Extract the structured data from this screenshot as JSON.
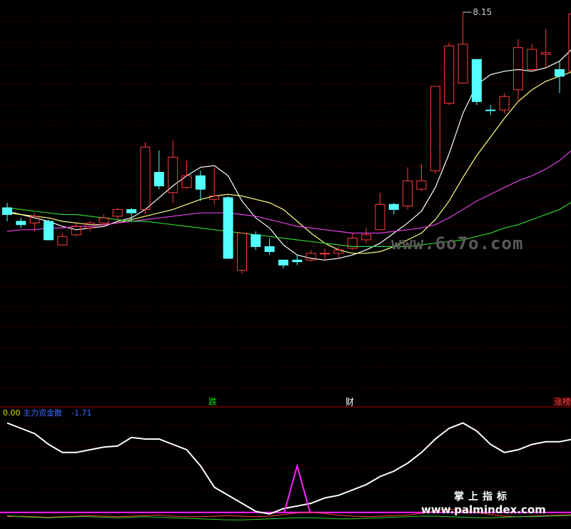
{
  "chart_data": {
    "type": "candlestick",
    "price_panel": {
      "max_label": "8.15",
      "candles": [
        {
          "o": 6.95,
          "c": 6.99,
          "h": 7.02,
          "l": 6.91,
          "up": false
        },
        {
          "o": 6.91,
          "c": 6.89,
          "h": 6.93,
          "l": 6.87,
          "up": false
        },
        {
          "o": 6.9,
          "c": 6.94,
          "h": 6.96,
          "l": 6.85,
          "up": true
        },
        {
          "o": 6.91,
          "c": 6.8,
          "h": 6.92,
          "l": 6.8,
          "up": false
        },
        {
          "o": 6.77,
          "c": 6.82,
          "h": 6.84,
          "l": 6.77,
          "up": true
        },
        {
          "o": 6.83,
          "c": 6.88,
          "h": 6.9,
          "l": 6.82,
          "up": true
        },
        {
          "o": 6.87,
          "c": 6.9,
          "h": 6.91,
          "l": 6.85,
          "up": true
        },
        {
          "o": 6.9,
          "c": 6.93,
          "h": 6.95,
          "l": 6.88,
          "up": true
        },
        {
          "o": 6.94,
          "c": 6.98,
          "h": 6.99,
          "l": 6.92,
          "up": true
        },
        {
          "o": 6.98,
          "c": 6.96,
          "h": 6.99,
          "l": 6.91,
          "up": false
        },
        {
          "o": 6.98,
          "c": 7.35,
          "h": 7.38,
          "l": 6.95,
          "up": true
        },
        {
          "o": 7.12,
          "c": 7.2,
          "h": 7.33,
          "l": 7.1,
          "up": false
        },
        {
          "o": 7.08,
          "c": 7.29,
          "h": 7.39,
          "l": 7.02,
          "up": true
        },
        {
          "o": 7.11,
          "c": 7.18,
          "h": 7.27,
          "l": 7.1,
          "up": true
        },
        {
          "o": 7.18,
          "c": 7.1,
          "h": 7.21,
          "l": 7.03,
          "up": false
        },
        {
          "o": 7.04,
          "c": 7.06,
          "h": 7.23,
          "l": 7.01,
          "up": true
        },
        {
          "o": 7.05,
          "c": 6.69,
          "h": 7.06,
          "l": 6.69,
          "up": false
        },
        {
          "o": 6.84,
          "c": 6.62,
          "h": 6.84,
          "l": 6.6,
          "up": true
        },
        {
          "o": 6.83,
          "c": 6.76,
          "h": 6.85,
          "l": 6.74,
          "up": false
        },
        {
          "o": 6.76,
          "c": 6.73,
          "h": 6.81,
          "l": 6.71,
          "up": false
        },
        {
          "o": 6.68,
          "c": 6.65,
          "h": 6.68,
          "l": 6.63,
          "up": false
        },
        {
          "o": 6.67,
          "c": 6.68,
          "h": 6.71,
          "l": 6.65,
          "up": false
        },
        {
          "o": 6.68,
          "c": 6.72,
          "h": 6.74,
          "l": 6.67,
          "up": true
        },
        {
          "o": 6.72,
          "c": 6.72,
          "h": 6.75,
          "l": 6.68,
          "up": true
        },
        {
          "o": 6.72,
          "c": 6.74,
          "h": 6.76,
          "l": 6.69,
          "up": true
        },
        {
          "o": 6.75,
          "c": 6.81,
          "h": 6.84,
          "l": 6.74,
          "up": true
        },
        {
          "o": 6.8,
          "c": 6.83,
          "h": 6.87,
          "l": 6.78,
          "up": true
        },
        {
          "o": 6.86,
          "c": 7.01,
          "h": 7.08,
          "l": 6.86,
          "up": true
        },
        {
          "o": 7.01,
          "c": 6.98,
          "h": 7.02,
          "l": 6.95,
          "up": false
        },
        {
          "o": 7.0,
          "c": 7.15,
          "h": 7.23,
          "l": 6.98,
          "up": true
        },
        {
          "o": 7.1,
          "c": 7.15,
          "h": 7.25,
          "l": 7.09,
          "up": true
        },
        {
          "o": 7.21,
          "c": 7.71,
          "h": 7.71,
          "l": 7.19,
          "up": true
        },
        {
          "o": 7.61,
          "c": 7.95,
          "h": 7.97,
          "l": 7.6,
          "up": true
        },
        {
          "o": 7.73,
          "c": 7.96,
          "h": 8.15,
          "l": 7.73,
          "up": true
        },
        {
          "o": 7.87,
          "c": 7.62,
          "h": 7.87,
          "l": 7.6,
          "up": false
        },
        {
          "o": 7.57,
          "c": 7.57,
          "h": 7.6,
          "l": 7.54,
          "up": false
        },
        {
          "o": 7.57,
          "c": 7.65,
          "h": 7.67,
          "l": 7.55,
          "up": true
        },
        {
          "o": 7.69,
          "c": 7.94,
          "h": 7.99,
          "l": 7.62,
          "up": true
        },
        {
          "o": 7.81,
          "c": 7.93,
          "h": 7.96,
          "l": 7.8,
          "up": true
        },
        {
          "o": 7.9,
          "c": 7.91,
          "h": 8.05,
          "l": 7.82,
          "up": true
        },
        {
          "o": 7.81,
          "c": 7.77,
          "h": 7.86,
          "l": 7.67,
          "up": false
        },
        {
          "o": 7.8,
          "c": 8.14,
          "h": 8.14,
          "l": 7.8,
          "up": true
        }
      ],
      "moving_averages": [
        {
          "color": "#ffffff",
          "values": [
            6.97,
            6.95,
            6.93,
            6.91,
            6.88,
            6.86,
            6.87,
            6.88,
            6.91,
            6.93,
            6.98,
            7.05,
            7.12,
            7.18,
            7.23,
            7.24,
            7.18,
            7.03,
            6.93,
            6.87,
            6.77,
            6.71,
            6.69,
            6.68,
            6.69,
            6.71,
            6.74,
            6.78,
            6.84,
            6.9,
            6.97,
            7.11,
            7.31,
            7.55,
            7.72,
            7.78,
            7.8,
            7.81,
            7.8,
            7.82,
            7.86,
            7.94
          ]
        },
        {
          "color": "#ffff80",
          "values": [
            6.96,
            6.95,
            6.94,
            6.93,
            6.91,
            6.9,
            6.89,
            6.89,
            6.9,
            6.92,
            6.94,
            6.96,
            6.98,
            7.01,
            7.04,
            7.06,
            7.07,
            7.06,
            7.04,
            7.02,
            6.98,
            6.91,
            6.84,
            6.78,
            6.74,
            6.72,
            6.72,
            6.73,
            6.76,
            6.8,
            6.84,
            6.92,
            7.03,
            7.17,
            7.3,
            7.41,
            7.52,
            7.62,
            7.69,
            7.74,
            7.77,
            7.8
          ]
        },
        {
          "color": "#e040e0",
          "values": [
            6.85,
            6.86,
            6.86,
            6.87,
            6.87,
            6.88,
            6.88,
            6.89,
            6.9,
            6.91,
            6.92,
            6.93,
            6.94,
            6.95,
            6.96,
            6.96,
            6.96,
            6.95,
            6.94,
            6.92,
            6.9,
            6.88,
            6.87,
            6.86,
            6.85,
            6.84,
            6.84,
            6.84,
            6.85,
            6.86,
            6.87,
            6.89,
            6.93,
            6.98,
            7.03,
            7.07,
            7.11,
            7.15,
            7.18,
            7.22,
            7.27,
            7.34
          ]
        },
        {
          "color": "#30d030",
          "values": [
            6.99,
            6.98,
            6.97,
            6.96,
            6.95,
            6.95,
            6.94,
            6.93,
            6.92,
            6.91,
            6.91,
            6.9,
            6.89,
            6.88,
            6.87,
            6.86,
            6.85,
            6.84,
            6.83,
            6.82,
            6.81,
            6.8,
            6.79,
            6.78,
            6.77,
            6.76,
            6.76,
            6.76,
            6.76,
            6.76,
            6.77,
            6.78,
            6.79,
            6.8,
            6.82,
            6.84,
            6.87,
            6.89,
            6.92,
            6.95,
            6.98,
            7.03
          ]
        }
      ]
    },
    "signals": [
      {
        "label": "跌",
        "index": 15
      },
      {
        "label": "财",
        "index": 25
      },
      {
        "label": "涨榜",
        "index": 41
      }
    ],
    "indicator_panel": {
      "value_label": "0.00",
      "name": "主力资金散",
      "reading": "-1.71",
      "main_line": {
        "color": "#ffffff",
        "values": [
          -0.05,
          -0.15,
          -0.25,
          -0.45,
          -0.6,
          -0.6,
          -0.55,
          -0.5,
          -0.48,
          -0.32,
          -0.35,
          -0.35,
          -0.45,
          -0.55,
          -0.85,
          -1.25,
          -1.4,
          -1.55,
          -1.7,
          -1.75,
          -1.65,
          -1.6,
          -1.55,
          -1.45,
          -1.4,
          -1.3,
          -1.2,
          -1.05,
          -0.95,
          -0.8,
          -0.6,
          -0.35,
          -0.15,
          -0.05,
          -0.2,
          -0.45,
          -0.6,
          -0.55,
          -0.45,
          -0.4,
          -0.4,
          -0.35
        ]
      },
      "spike": {
        "color": "#ff20ff",
        "index": 21,
        "base": -1.72,
        "peak": -0.85
      },
      "zero_line": {
        "color": "#ff20ff",
        "value": -1.72
      },
      "sub_lines": [
        {
          "color": "#ff4040",
          "values": [
            -1.8,
            -1.79,
            -1.8,
            -1.81,
            -1.8,
            -1.79,
            -1.78,
            -1.79,
            -1.8,
            -1.79,
            -1.78,
            -1.77,
            -1.79,
            -1.8,
            -1.8,
            -1.79,
            -1.78,
            -1.79,
            -1.8,
            -1.79,
            -1.76,
            -1.73,
            -1.72,
            -1.74,
            -1.77,
            -1.79,
            -1.8,
            -1.79,
            -1.78,
            -1.77,
            -1.74,
            -1.69,
            -1.66,
            -1.68,
            -1.72,
            -1.76,
            -1.79,
            -1.8,
            -1.79,
            -1.78,
            -1.77,
            -1.76
          ]
        },
        {
          "color": "#30d030",
          "values": [
            -1.78,
            -1.8,
            -1.81,
            -1.82,
            -1.81,
            -1.8,
            -1.8,
            -1.81,
            -1.82,
            -1.81,
            -1.8,
            -1.81,
            -1.82,
            -1.83,
            -1.84,
            -1.85,
            -1.86,
            -1.86,
            -1.85,
            -1.84,
            -1.83,
            -1.82,
            -1.82,
            -1.83,
            -1.84,
            -1.84,
            -1.83,
            -1.82,
            -1.81,
            -1.8,
            -1.79,
            -1.79,
            -1.8,
            -1.81,
            -1.82,
            -1.82,
            -1.81,
            -1.8,
            -1.8,
            -1.79,
            -1.78,
            -1.78
          ]
        }
      ]
    },
    "watermarks": [
      "www.6o7o.com",
      "掌上指标",
      "www.palmindex.com"
    ]
  }
}
